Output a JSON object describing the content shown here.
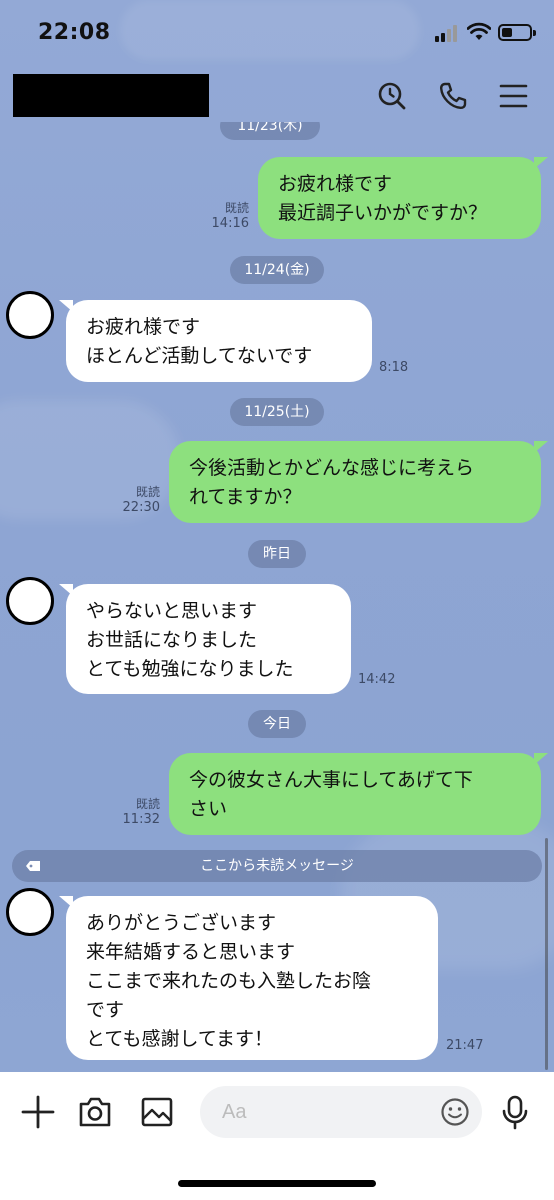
{
  "status_bar": {
    "time": "22:08"
  },
  "header": {
    "name_redacted": true
  },
  "dates": {
    "partial_top": "11/23(木)",
    "d1": "11/24(金)",
    "d2": "11/25(土)",
    "d3": "昨日",
    "d4": "今日"
  },
  "messages": [
    {
      "side": "out",
      "lines": [
        "お疲れ様です",
        "最近調子いかがですか？"
      ],
      "read": "既読",
      "time": "14:16"
    },
    {
      "side": "in",
      "lines": [
        "お疲れ様です",
        "ほとんど活動してないです"
      ],
      "time": "8:18"
    },
    {
      "side": "out",
      "lines": [
        "今後活動とかどんな感じに考えら",
        "れてますか？"
      ],
      "read": "既読",
      "time": "22:30"
    },
    {
      "side": "in",
      "lines": [
        "やらないと思います",
        "お世話になりました",
        "とても勉強になりました"
      ],
      "time": "14:42"
    },
    {
      "side": "out",
      "lines": [
        "今の彼女さん大事にしてあげて下",
        "さい"
      ],
      "read": "既読",
      "time": "11:32"
    },
    {
      "side": "in",
      "lines": [
        "ありがとうございます",
        "来年結婚すると思います",
        "ここまで来れたのも入塾したお陰",
        "です",
        "とても感謝してます！"
      ],
      "time": "21:47"
    }
  ],
  "unread_divider": "ここから未読メッセージ",
  "input": {
    "placeholder": "Aa"
  },
  "icons": {
    "header": [
      "search-icon",
      "phone-icon",
      "menu-icon"
    ],
    "bottom": [
      "plus-icon",
      "camera-icon",
      "image-icon",
      "emoji-icon",
      "microphone-icon"
    ]
  },
  "colors": {
    "background": "#8FA6D4",
    "outgoing_bubble": "#8DE07E",
    "incoming_bubble": "#FFFFFF"
  }
}
